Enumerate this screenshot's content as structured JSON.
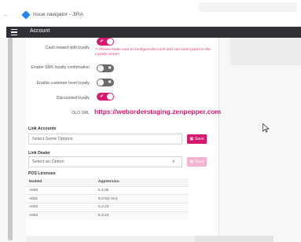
{
  "browser": {
    "back_glyph": "←",
    "tab_title": "Issue navigator - JIRA"
  },
  "header": {
    "title": "Account"
  },
  "settings": [
    {
      "label": "Cash reward with loyalty",
      "toggle": "on"
    },
    {
      "label": "Enable SMS loyalty confirmation",
      "toggle": "off"
    },
    {
      "label": "Enable customer level loyalty",
      "toggle": "off"
    },
    {
      "label": "Discounted loyalty",
      "toggle": "on"
    }
  ],
  "cash_note": "** Please make sure to configure the cash and non-cash points in the Loyalty screen",
  "olo": {
    "label": "OLO URL",
    "value": "https://weborderstaging.zenpepper.com"
  },
  "toggle_marks": {
    "on": "✔",
    "off": "✖"
  },
  "link_accounts": {
    "label": "Link Accounts",
    "placeholder": "Select Some Options",
    "save_label": "Save"
  },
  "link_dealer": {
    "label": "Link Dealer",
    "placeholder": "Select an Option",
    "caret": "▼",
    "save_label": "Save"
  },
  "pos_licenses": {
    "label": "POS Licenses",
    "columns": [
      "NodeId",
      "AppVersion"
    ],
    "rows": [
      [
        "A000",
        "5.3.05"
      ],
      [
        "A001",
        "5.0.6(1.0m)"
      ],
      [
        "A002",
        "5.3.23"
      ],
      [
        "A003",
        "5.3.23"
      ]
    ]
  },
  "colors": {
    "accent": "#d6196e",
    "header_bg": "#2f3136",
    "toggle_off": "#6b6b6b"
  }
}
